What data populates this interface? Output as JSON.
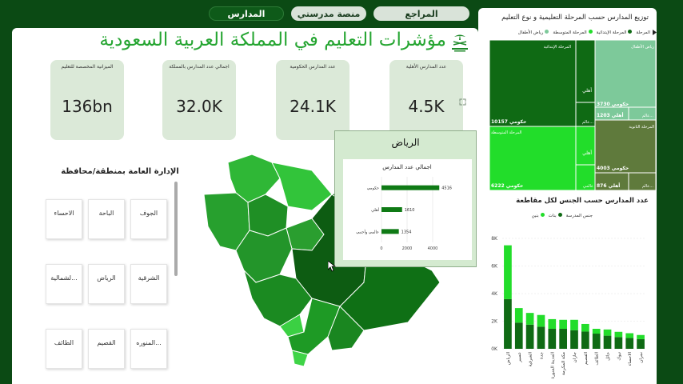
{
  "nav": {
    "tabs": [
      {
        "label": "المدارس",
        "active": true
      },
      {
        "label": "منصة مدرستي",
        "active": false
      },
      {
        "label": "المراجع",
        "active": false
      }
    ]
  },
  "header": {
    "title": "مؤشرات التعليم في المملكة العربية السعودية"
  },
  "kpis": [
    {
      "label": "عدد المدارس الأهلية",
      "value": "4.5K"
    },
    {
      "label": "عدد المدارس الحكومية",
      "value": "24.1K"
    },
    {
      "label": "اجمالي عدد المدارس بالمملكة",
      "value": "32.0K"
    },
    {
      "label": "الميزانية المخصصة للتعليم",
      "value": "136bn"
    }
  ],
  "slicer": {
    "title": "الإدارة العامة بمنطقة/محافظة",
    "items": [
      "الجوف",
      "الباحة",
      "الاحساء",
      "الشرقية",
      "الرياض",
      "...لشمالية",
      "...المنوره",
      "القصيم",
      "الطائف"
    ]
  },
  "tooltip": {
    "region": "الرياض",
    "chart_title": "اجمالي عدد المدارس",
    "ticks": [
      "0",
      "2000",
      "4000"
    ]
  },
  "treemap": {
    "title": "توزيع المدارس حسب المرحلة التعليمية و نوع التعليم",
    "legend_label": "المرحلة",
    "legend": [
      {
        "name": "رياض الأطفال",
        "color": "#7dc99a"
      },
      {
        "name": "المرحلة الإبتدائية",
        "color": "#0f6a14"
      },
      {
        "name": "المرحلة المتوسطة",
        "color": "#22dd2a"
      },
      {
        "name": "المرحلة الثانوية",
        "color": "#5f7a3c"
      }
    ],
    "cells": {
      "primary_header": "المرحلة الإبتدائية",
      "primary_gov": "حكومي 10157",
      "primary_private": "أهلي",
      "primary_intl": "عالم...",
      "middle_header": "المرحلة المتوسطة",
      "middle_gov": "حكومي 6222",
      "middle_private": "أهلي",
      "middle_intl": "عالمي",
      "kg_header": "رياض الأطفال",
      "kg_gov": "حكومي 3730",
      "kg_private": "أهلي 1203",
      "kg_intl": "عالم...",
      "sec_header": "المرحلة الثانوية",
      "sec_gov": "حكومي 4003",
      "sec_private": "أهلي 876",
      "sec_intl": "عالم..."
    }
  },
  "gender_chart": {
    "title": "عدد المدارس حسب الجنس لكل مقاطعة",
    "legend_label": "جنس المدرسة",
    "legend": [
      {
        "name": "بنات",
        "color": "#0f6a14"
      },
      {
        "name": "بنين",
        "color": "#22dd2a"
      }
    ]
  },
  "chart_data": [
    {
      "type": "bar",
      "title": "اجمالي عدد المدارس",
      "categories": [
        "حكومي",
        "أهلي",
        "عالمي وأجنبي"
      ],
      "values": [
        4516,
        1610,
        1354
      ],
      "xlim": [
        0,
        5000
      ]
    },
    {
      "type": "bar",
      "title": "عدد المدارس حسب الجنس لكل مقاطعة",
      "categories": [
        "الرياض",
        "عسير",
        "الشرقية",
        "جدة",
        "المدينة المنورة",
        "مكة المكرمة",
        "جازان",
        "القصيم",
        "الطائف",
        "حائل",
        "تبوك",
        "الاحساء",
        "نجران"
      ],
      "series": [
        {
          "name": "بنات",
          "values": [
            3600,
            1900,
            1750,
            1600,
            1450,
            1450,
            1350,
            1250,
            1100,
            950,
            850,
            780,
            700
          ]
        },
        {
          "name": "بنين",
          "values": [
            3900,
            1050,
            850,
            850,
            700,
            650,
            750,
            550,
            350,
            450,
            380,
            350,
            300
          ]
        }
      ],
      "yticks": [
        "0K",
        "2K",
        "4K",
        "6K",
        "8K"
      ],
      "ylim": [
        0,
        8000
      ],
      "stacked": true
    }
  ]
}
